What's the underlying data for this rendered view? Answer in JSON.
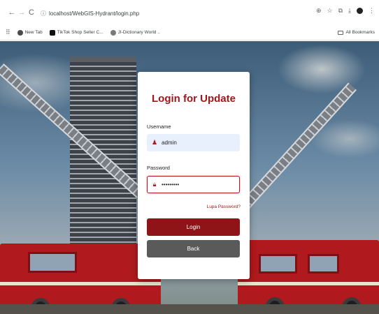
{
  "browser": {
    "url": "localhost/WebGIS-Hydrant/login.php",
    "nav": {
      "back": "←",
      "forward": "→",
      "reload": "C"
    },
    "right_icons": {
      "translate": "⊕",
      "star": "☆",
      "tab": "⧉",
      "download": "⤓",
      "menu": "⋮"
    },
    "bookmarks": [
      {
        "label": "New Tab",
        "icon_color": "#4a4a4a"
      },
      {
        "label": "TikTok Shop Seller C...",
        "icon_color": "#111111"
      },
      {
        "label": "JI-Dictionary World ..",
        "icon_color": "#7a7a7a"
      }
    ],
    "all_bookmarks": "All Bookmarks"
  },
  "login": {
    "title": "Login for Update",
    "username_label": "Username",
    "username_value": "admin",
    "password_label": "Password",
    "password_value": "•••••••••",
    "forgot_link": "Lupa Password?",
    "login_button": "Login",
    "back_button": "Back"
  },
  "colors": {
    "accent": "#a0161b",
    "login_button": "#8e1418",
    "back_button": "#5a5a5a",
    "username_bg": "#e8f0fe"
  }
}
